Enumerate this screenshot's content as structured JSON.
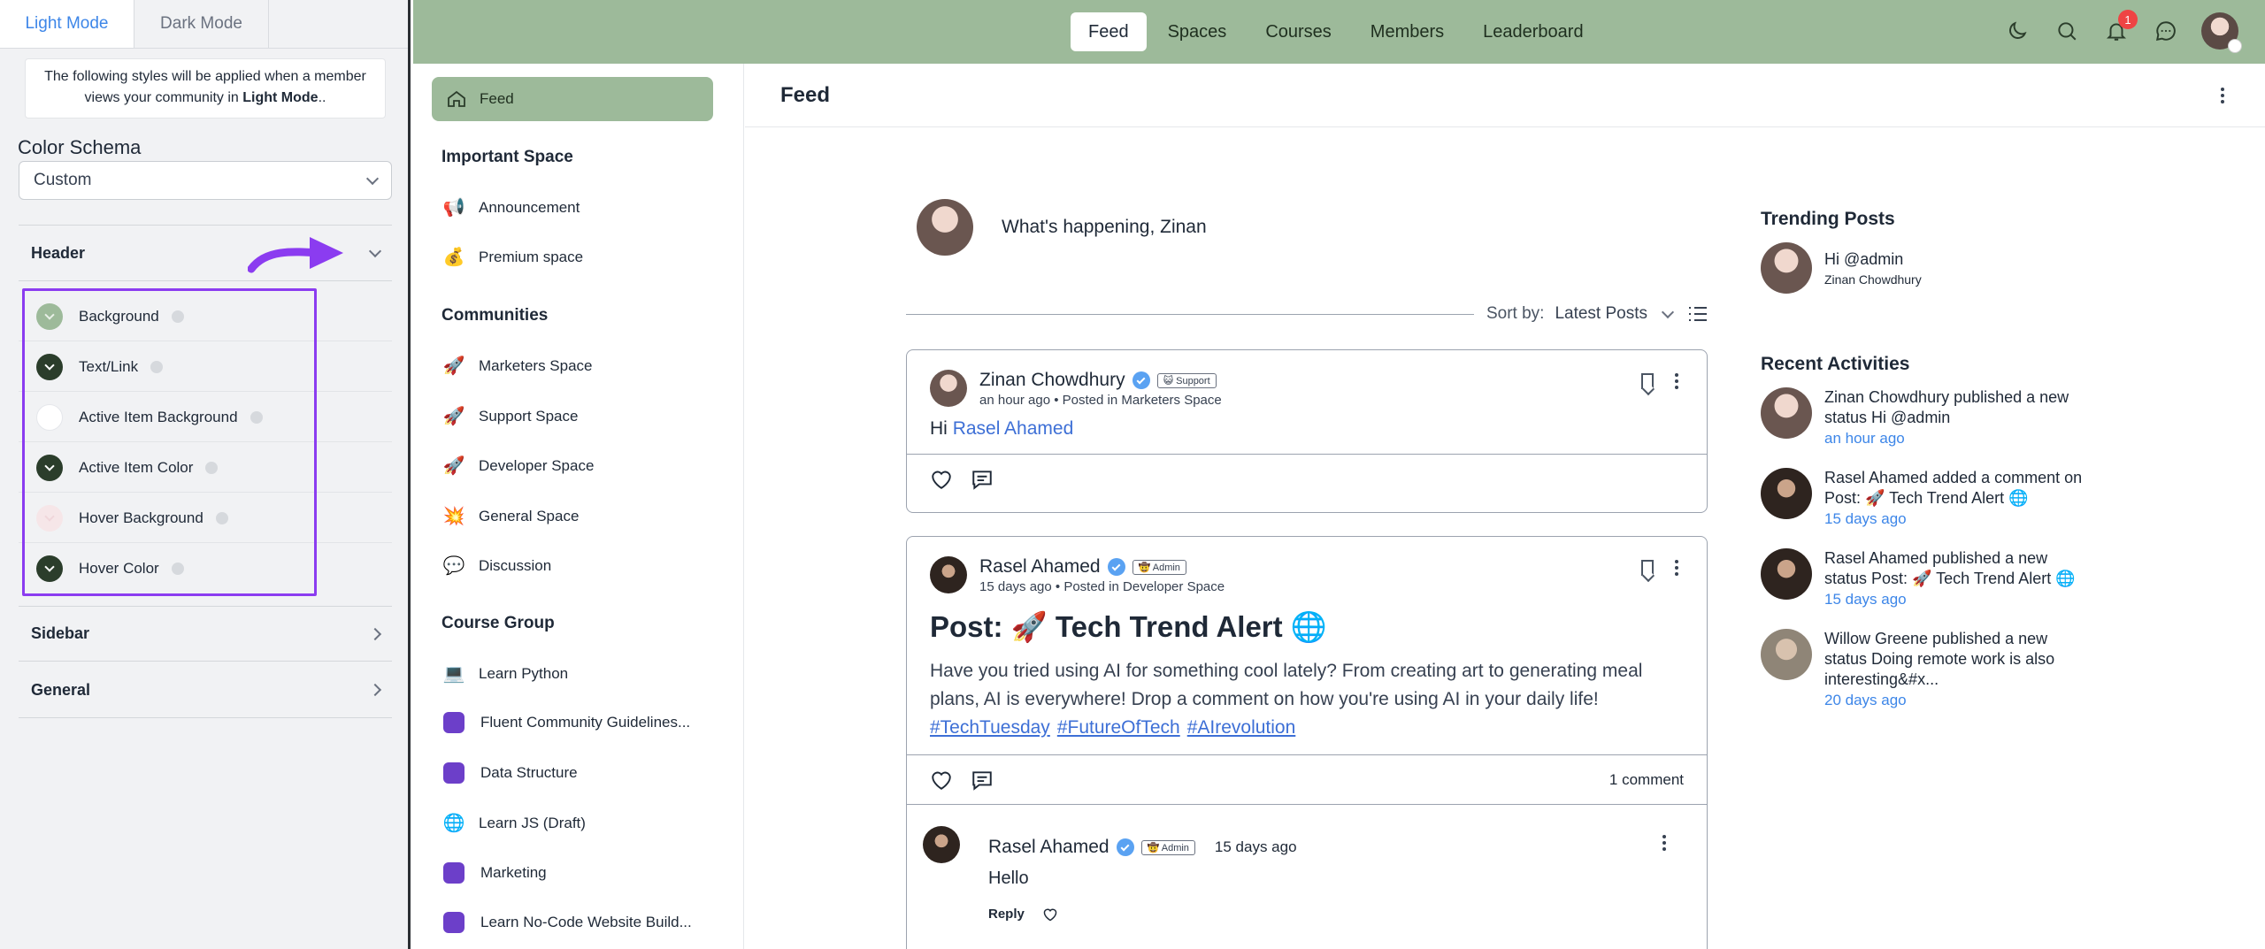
{
  "settings": {
    "tabs": [
      "Light Mode",
      "Dark Mode"
    ],
    "notice_pre": "The following styles will be applied when a member views your community in ",
    "notice_bold": "Light Mode",
    "notice_post": "..",
    "color_schema_label": "Color Schema",
    "color_schema_value": "Custom",
    "header_label": "Header",
    "items": [
      {
        "label": "Background",
        "color": "#9dba9a"
      },
      {
        "label": "Text/Link",
        "color": "#2b3d2b"
      },
      {
        "label": "Active Item Background",
        "color": "#ffffff"
      },
      {
        "label": "Active Item Color",
        "color": "#2b3d2b"
      },
      {
        "label": "Hover Background",
        "color": "#f6e6e8"
      },
      {
        "label": "Hover Color",
        "color": "#2b3d2b"
      }
    ],
    "sidebar_label": "Sidebar",
    "general_label": "General",
    "highlight_color": "#8b3cf0"
  },
  "topnav": {
    "items": [
      "Feed",
      "Spaces",
      "Courses",
      "Members",
      "Leaderboard"
    ],
    "notification_count": "1",
    "bar_color": "#9dba9a"
  },
  "sidebar": {
    "feed_label": "Feed",
    "groups": [
      {
        "title": "Important Space",
        "items": [
          {
            "icon": "📢",
            "label": "Announcement"
          },
          {
            "icon": "💰",
            "label": "Premium space"
          }
        ]
      },
      {
        "title": "Communities",
        "items": [
          {
            "icon": "🚀",
            "label": "Marketers Space"
          },
          {
            "icon": "🚀",
            "label": "Support Space"
          },
          {
            "icon": "🚀",
            "label": "Developer Space"
          },
          {
            "icon": "💥",
            "label": "General Space"
          },
          {
            "icon": "💬",
            "label": "Discussion"
          }
        ]
      },
      {
        "title": "Course Group",
        "items": [
          {
            "icon": "💻",
            "label": "Learn Python"
          },
          {
            "icon": "",
            "label": "Fluent Community Guidelines..."
          },
          {
            "icon": "",
            "label": "Data Structure"
          },
          {
            "icon": "🌐",
            "label": "Learn JS (Draft)"
          },
          {
            "icon": "",
            "label": "Marketing"
          },
          {
            "icon": "",
            "label": "Learn No-Code Website Build..."
          }
        ]
      }
    ]
  },
  "feed": {
    "title": "Feed",
    "composer_placeholder": "What's happening, Zinan",
    "sort_label": "Sort by:",
    "sort_value": "Latest Posts",
    "post1": {
      "author": "Zinan Chowdhury",
      "role": "😺 Support",
      "meta": "an hour ago • Posted in Marketers Space",
      "greeting": "Hi",
      "mention": "Rasel Ahamed"
    },
    "post2": {
      "author": "Rasel Ahamed",
      "role": "🤠 Admin",
      "meta": "15 days ago • Posted in Developer Space",
      "title": "Post: 🚀 Tech Trend Alert 🌐",
      "body": "Have you tried using AI for something cool lately? From creating art to generating meal plans, AI is everywhere! Drop a comment on how you're using AI in your daily life!",
      "tags": [
        "#TechTuesday",
        "#FutureOfTech",
        "#AIrevolution"
      ],
      "comments_count": "1 comment",
      "comment": {
        "author": "Rasel Ahamed",
        "role": "🤠 Admin",
        "time": "15 days ago",
        "text": "Hello",
        "reply_label": "Reply"
      }
    }
  },
  "rail": {
    "trending_title": "Trending Posts",
    "trending": {
      "title": "Hi @admin",
      "author": "Zinan Chowdhury"
    },
    "recent_title": "Recent Activities",
    "activities": [
      {
        "text": "Zinan Chowdhury published a new status Hi @admin",
        "when": "an hour ago"
      },
      {
        "text": "Rasel Ahamed added a comment on Post: 🚀 Tech Trend Alert 🌐",
        "when": "15 days ago"
      },
      {
        "text": "Rasel Ahamed published a new status Post: 🚀 Tech Trend Alert 🌐",
        "when": "15 days ago"
      },
      {
        "text": "Willow Greene published a new status Doing remote work is also interesting&#x...",
        "when": "20 days ago"
      }
    ]
  }
}
